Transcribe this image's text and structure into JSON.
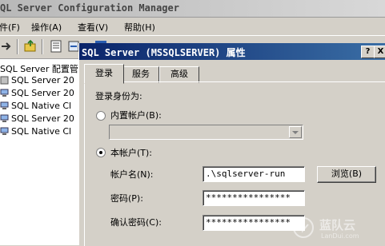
{
  "app": {
    "title": "QL Server Configuration Manager",
    "menu": [
      "件(F)",
      "操作(A)",
      "查看(V)",
      "帮助(H)"
    ]
  },
  "tree": {
    "root": "SQL Server 配置管",
    "items": [
      "SQL Server 20",
      "SQL Server 20",
      "SQL Native Cl",
      "SQL Server 20",
      "SQL Native Cl"
    ]
  },
  "dialog": {
    "title": "SQL Server (MSSQLSERVER) 属性",
    "help_btn": "?",
    "close_btn": "X",
    "tabs": [
      "登录",
      "服务",
      "高级"
    ],
    "logon_as": "登录身份为:",
    "builtin_label": "内置帐户(B):",
    "builtin_value": "",
    "this_account_label": "本帐户(T):",
    "account_name_label": "帐户名(N):",
    "account_name_value": ".\\sqlserver-run",
    "browse_btn": "浏览(B)",
    "password_label": "密码(P):",
    "password_value": "****************",
    "confirm_label": "确认密码(C):",
    "confirm_value": "****************"
  },
  "watermark": {
    "text": "蓝队云",
    "subtext": "LanDui.com"
  },
  "colors": {
    "titlebar": "#0a246a",
    "face": "#d4d0c8"
  }
}
